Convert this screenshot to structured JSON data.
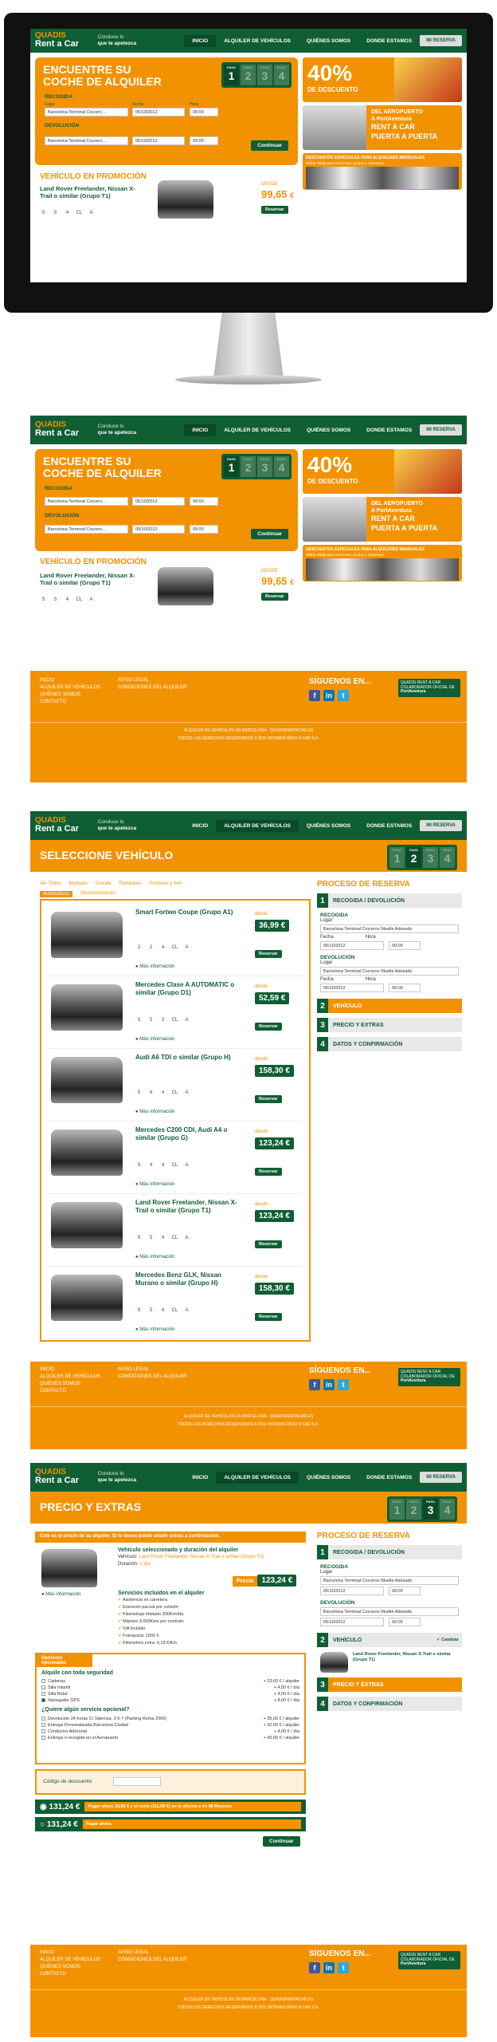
{
  "nav": {
    "logo_line1": "QUADIS",
    "logo_line2": "Rent a Car",
    "tagline_line1": "Conduce lo",
    "tagline_line2": "que te apetezca",
    "menu": [
      "INICIO",
      "ALQUILER DE VEHÍCULOS",
      "QUIÉNES SOMOS",
      "DONDE ESTAMOS"
    ],
    "my_booking": "MI RESERVA"
  },
  "home": {
    "search_title_1": "ENCUENTRE SU",
    "search_title_2": "COCHE DE ALQUILER",
    "step_label": "PASO",
    "steps": [
      "1",
      "2",
      "3",
      "4"
    ],
    "pickup_label": "RECOGIDA",
    "return_label": "DEVOLUCIÓN",
    "place_label": "Lugar",
    "date_label": "Fecha",
    "time_label": "Hora",
    "place_value": "Barcelona Terminal Crucero...",
    "date_value": "05/10/2012",
    "time_value": "09:00",
    "continue": "Continuar",
    "promo_title": "VEHÍCULO EN PROMOCIÓN",
    "promo_car": "Land Rover Freelander, Nissan X-Trail o similar (Grupo T1)",
    "promo_from": "DESDE",
    "promo_price": "99,65",
    "currency": "€",
    "reserve": "Reservar",
    "features": [
      "5",
      "5",
      "4",
      "CL",
      "A"
    ],
    "banner1_pct": "40%",
    "banner1_sub": "DE DESCUENTO",
    "banner2_l1": "DEL AEROPUERTO",
    "banner2_l2": "A PortAventura",
    "banner2_l3": "RENT A CAR",
    "banner2_l4": "PUERTA A PUERTA",
    "banner3_l1": "DESCUENTOS ESPECIALES PARA ALQUILERES MENSUALES",
    "banner3_l2": "Oferta válida para empresas, grupos y colectivos."
  },
  "footer": {
    "links_col1": [
      "INICIO",
      "ALQUILER DE VEHÍCULOS",
      "QUIÉNES SOMOS",
      "CONTACTO"
    ],
    "links_col2": [
      "AVISO LEGAL",
      "CONDICIONES DEL ALQUILER"
    ],
    "follow": "SÍGUENOS EN...",
    "pa_text": "QUADIS RENT A CAR COLABORADOR OFICIAL DE",
    "pa_brand": "PortAventura",
    "copy1": "ALQUILER DE VEHÍCULOS EN BARCELONA · QUADISRENTACAR.ES",
    "copy2": "TODOS LOS DERECHOS RESERVADOS © 2011 MITRANS RENT A CAR S.A."
  },
  "select": {
    "title": "SELECCIONE VEHÍCULO",
    "tabs": [
      "Ver Todos",
      "Mediano",
      "Grande",
      "Familiares",
      "Premium y 4x4"
    ],
    "subtabs": [
      "Automáticos",
      "Monovolúmenes"
    ],
    "from": "desde",
    "more_info": "Más información",
    "reserve": "Reservar",
    "cars": [
      {
        "name": "Smart Fortwo Coupe (Grupo A1)",
        "price": "36,99 €",
        "feat": [
          "2",
          "2",
          "4",
          "CL",
          "A"
        ]
      },
      {
        "name": "Mercedes Clase A AUTOMATIC o similar (Grupo D1)",
        "price": "52,59 €",
        "feat": [
          "5",
          "5",
          "3",
          "CL",
          "A"
        ]
      },
      {
        "name": "Audi A6 TDI o similar (Grupo H)",
        "price": "158,30 €",
        "feat": [
          "5",
          "4",
          "4",
          "CL",
          "A"
        ]
      },
      {
        "name": "Mercedes C200 CDI, Audi A4 o similar (Grupo G)",
        "price": "123,24 €",
        "feat": [
          "5",
          "4",
          "4",
          "CL",
          "A"
        ]
      },
      {
        "name": "Land Rover Freelander, Nissan X-Trail o similar (Grupo T1)",
        "price": "123,24 €",
        "feat": [
          "5",
          "5",
          "4",
          "CL",
          "A"
        ]
      },
      {
        "name": "Mercedes Benz GLK, Nissan Murano o similar (Grupo H)",
        "price": "158,30 €",
        "feat": [
          "5",
          "5",
          "4",
          "CL",
          "A"
        ]
      }
    ]
  },
  "sidebar": {
    "title": "PROCESO DE RESERVA",
    "step1": "RECOGIDA / DEVOLUCIÓN",
    "step2": "VEHÍCULO",
    "step3": "PRECIO Y EXTRAS",
    "step4": "DATOS Y CONFIRMACIÓN",
    "pickup": "RECOGIDA",
    "return": "DEVOLUCIÓN",
    "place": "Lugar",
    "place_value": "Barcelona Terminal Cruceros Muelle Adosado",
    "date": "Fecha",
    "time": "Hora",
    "date_value": "05/10/2012",
    "time_value": "09:00",
    "change_info": "Información del vehículo",
    "change": "Cambiar",
    "chosen_car": "Land Rover Freelander, Nissan X-Trail o similar (Grupo T1)",
    "step_label": "PASO"
  },
  "extras": {
    "title": "PRECIO Y EXTRAS",
    "note": "Este es el precio de su alquiler. Si lo desea puede añadir extras a continuación.",
    "vehicle_h": "Vehículo seleccionado y duración del alquiler",
    "vehicle_l": "Vehículo:",
    "vehicle_v": "Land Rover Freelander, Nissan X-Trail o similar (Grupo T1)",
    "duration_l": "Duración:",
    "duration_v": "1 día",
    "price_l": "Precio",
    "price_v": "123,24 €",
    "more_info": "Más información",
    "included_h": "Servicios incluidos en el alquiler",
    "included": [
      "Asistencia en carretera",
      "Exención parcial por colisión",
      "Kilometraje limitado 300Km/día",
      "Máximo 3.000Kms por contrato",
      "IVA incluido",
      "Franquicia: 1000 €",
      "Kilómetros extra: 0,18 €/Km"
    ],
    "optional_h": "Servicios opcionales",
    "security_h": "Alquile con toda seguridad",
    "security": [
      {
        "name": "Cadenas",
        "price": "+ 23,60 € / alquiler"
      },
      {
        "name": "Silla Infantil",
        "price": "+ 4,50 € / día"
      },
      {
        "name": "Silla Bebé",
        "price": "+ 4,50 € / día"
      },
      {
        "name": "Navegador GPS",
        "price": "+ 8,00 € / día"
      }
    ],
    "more_h": "¿Quiere algún servicio opcional?",
    "more": [
      {
        "name": "Devolución 24 horas C/ Valencia, 3-5-7 (Parking Roma 2000)",
        "price": "+ 35,00 € / alquiler"
      },
      {
        "name": "Entrega Personalizada Barcelona Ciudad",
        "price": "+ 20,00 € / alquiler"
      },
      {
        "name": "Conductor Adicional",
        "price": "+ 4,00 € / día"
      },
      {
        "name": "Entrega o recogida en el Aeropuerto",
        "price": "+ 50,00 € / alquiler"
      }
    ],
    "discount_l": "Código de descuento",
    "pay1_price": "131,24 €",
    "pay1_text": "Pagar ahora 19,66 € y el resto (111,58 €) en la oficina o en 48 Reserva",
    "pay2_price": "131,24 €",
    "pay2_text": "Pagar ahora",
    "continue": "Continuar"
  }
}
